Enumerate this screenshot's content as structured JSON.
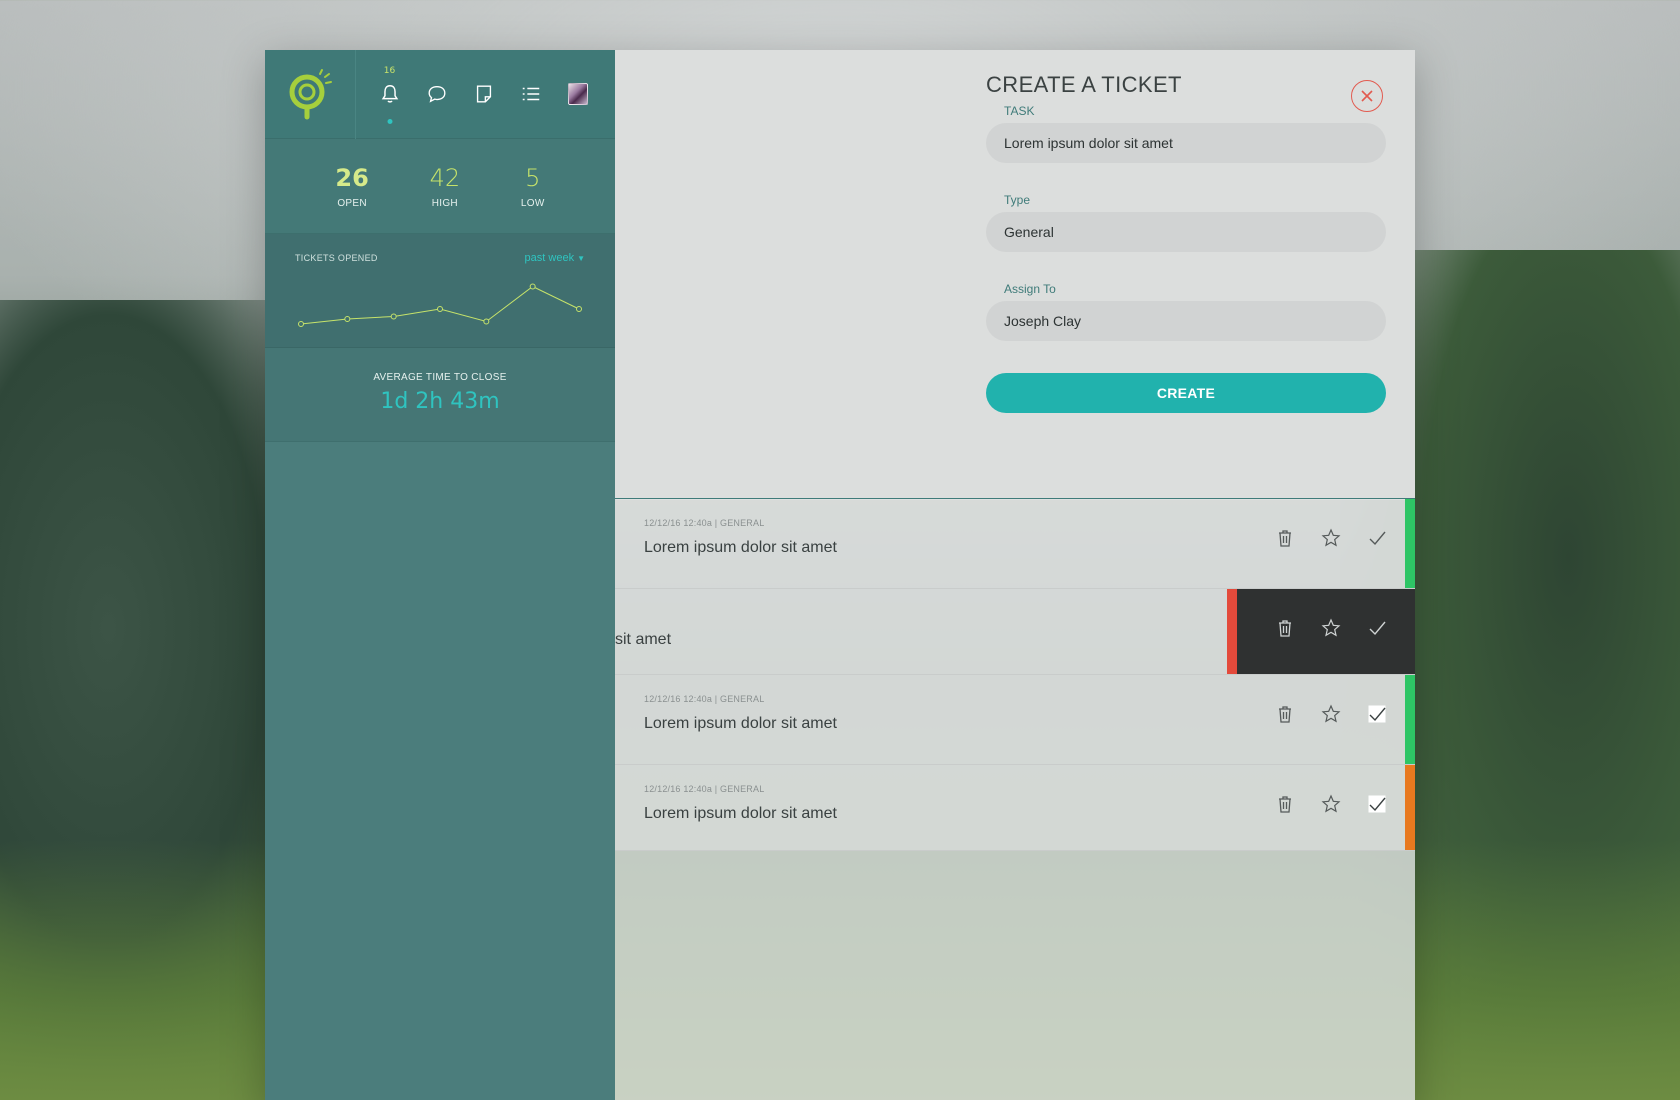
{
  "header": {
    "notification_count": "16",
    "icons": [
      "bell-icon",
      "chat-icon",
      "note-icon",
      "list-icon",
      "avatar"
    ]
  },
  "stats": [
    {
      "value": "26",
      "label": "OPEN"
    },
    {
      "value": "42",
      "label": "HIGH"
    },
    {
      "value": "5",
      "label": "LOW"
    }
  ],
  "chart_panel": {
    "title": "TICKETS OPENED",
    "range": "past week"
  },
  "chart_data": {
    "type": "line",
    "x": [
      1,
      2,
      3,
      4,
      5,
      6,
      7
    ],
    "values": [
      2,
      4,
      5,
      8,
      3,
      17,
      8
    ],
    "ylim": [
      0,
      20
    ],
    "grid": false,
    "color": "#c6e36a"
  },
  "avg_close": {
    "label": "AVERAGE TIME TO CLOSE",
    "value": "1d 2h 43m"
  },
  "form": {
    "title": "CREATE A TICKET",
    "task_label": "TASK",
    "task_value": "Lorem ipsum dolor sit amet",
    "type_label": "Type",
    "type_value": "General",
    "assign_label": "Assign To",
    "assign_value": "Joseph Clay",
    "create_label": "CREATE"
  },
  "tickets": [
    {
      "meta": "12/12/16  12:40a  |  GENERAL",
      "title": "Lorem ipsum dolor sit amet",
      "priority_color": "#2ec565",
      "swiped": false
    },
    {
      "meta": "",
      "title": "sit amet",
      "priority_color": "#e34a3b",
      "swiped": true
    },
    {
      "meta": "12/12/16  12:40a  |  GENERAL",
      "title": "Lorem ipsum dolor sit amet",
      "priority_color": "#2ec565",
      "swiped": false
    },
    {
      "meta": "12/12/16  12:40a  |  GENERAL",
      "title": "Lorem ipsum dolor sit amet",
      "priority_color": "#e8791f",
      "swiped": false
    }
  ],
  "colors": {
    "accent": "#21b2ad",
    "sidebar": "#4b7d7c",
    "close": "#e25a4f"
  }
}
